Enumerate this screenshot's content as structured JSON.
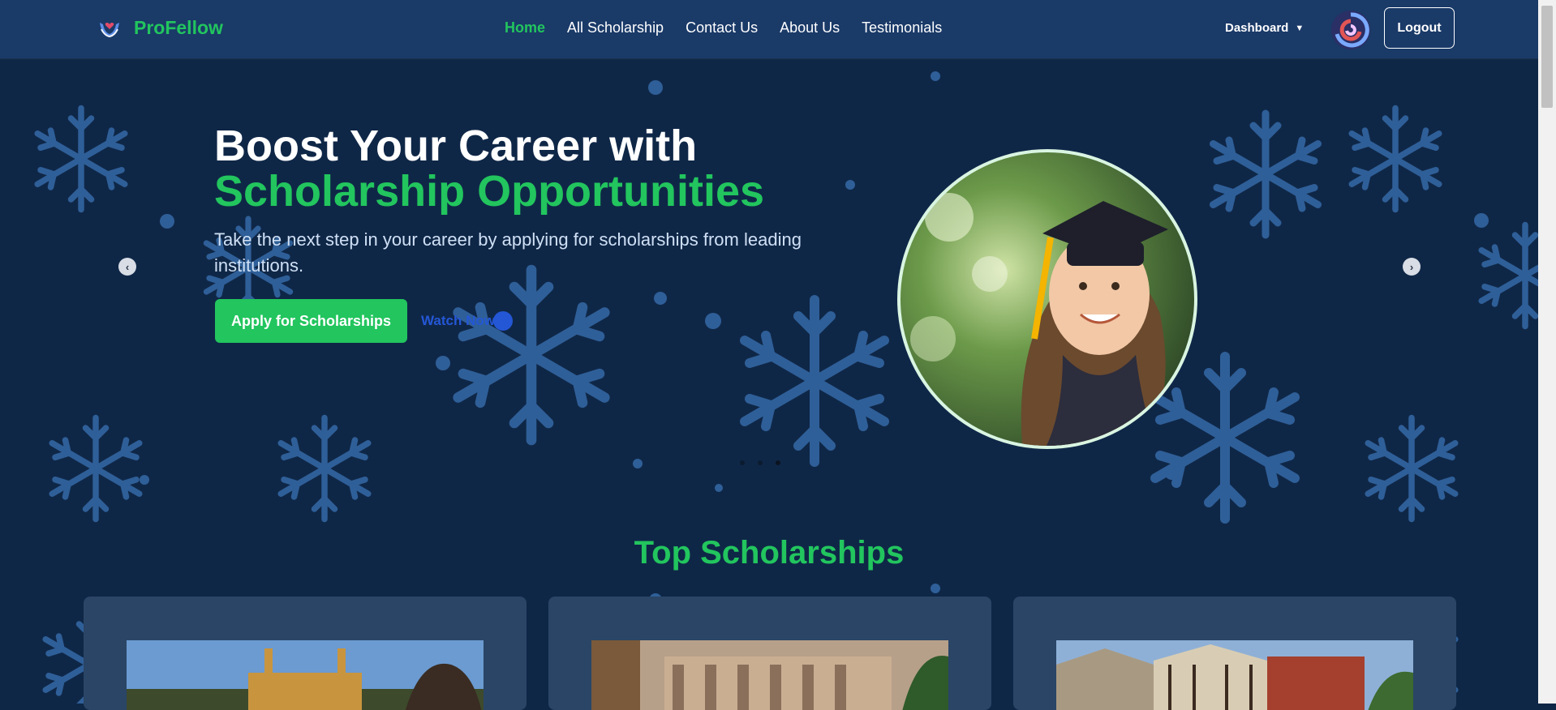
{
  "navbar": {
    "brand": "ProFellow",
    "links": [
      "Home",
      "All Scholarship",
      "Contact Us",
      "About Us",
      "Testimonials"
    ],
    "active_link": "Home",
    "dashboard_label": "Dashboard",
    "logout_label": "Logout"
  },
  "hero": {
    "title_line1": "Boost Your Career with",
    "title_line2": "Scholarship Opportunities",
    "subtitle": "Take the next step in your career by applying for scholarships from leading institutions.",
    "apply_label": "Apply for Scholarships",
    "watch_label": "Watch Now",
    "slide_count": 3,
    "active_slide": 3
  },
  "top_scholarships": {
    "title": "Top Scholarships",
    "cards": [
      {
        "image": "gothic-chapel-photo"
      },
      {
        "image": "classical-building-photo"
      },
      {
        "image": "tudor-college-photo"
      }
    ]
  },
  "colors": {
    "accent": "#22c55e",
    "navbar": "#1a3a68",
    "background": "#0f2747",
    "snowflake": "#2f5f98",
    "watch_link": "#2457d6"
  }
}
